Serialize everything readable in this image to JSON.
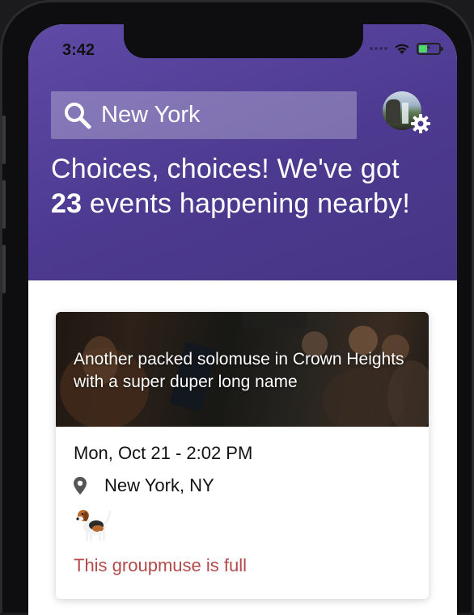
{
  "status_bar": {
    "time": "3:42"
  },
  "search": {
    "value": "New York",
    "icon": "search-icon"
  },
  "profile": {
    "avatar_icon": "avatar",
    "settings_icon": "gear-icon"
  },
  "headline": {
    "line_prefix": "Choices, choices! We've got",
    "count": "23",
    "line_suffix": " events happening nearby!"
  },
  "events": [
    {
      "title": "Another packed solomuse in Crown Heights with a super duper long name",
      "date": "Mon, Oct 21 - 2:02 PM",
      "location": "New York, NY",
      "host_icon": "beagle-icon",
      "status": "This groupmuse is full"
    }
  ],
  "colors": {
    "header_purple": "#4d3a90",
    "status_red": "#b3494b"
  }
}
